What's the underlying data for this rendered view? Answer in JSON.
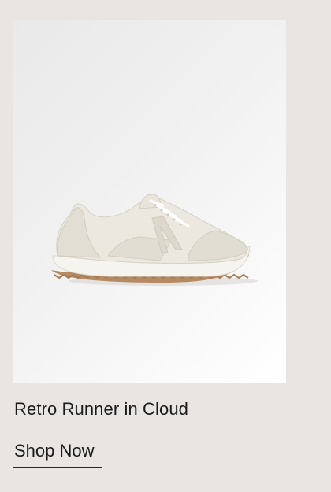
{
  "product": {
    "title": "Retro Runner in Cloud",
    "image_icon": "sneaker-image",
    "colors": {
      "background": "#e8e5e2",
      "image_bg": "#f1f1f1",
      "shoe_upper": "#ece8df",
      "sole_gum": "#b68a62",
      "text": "#1a1a1a"
    }
  },
  "cta": {
    "label": "Shop Now"
  }
}
